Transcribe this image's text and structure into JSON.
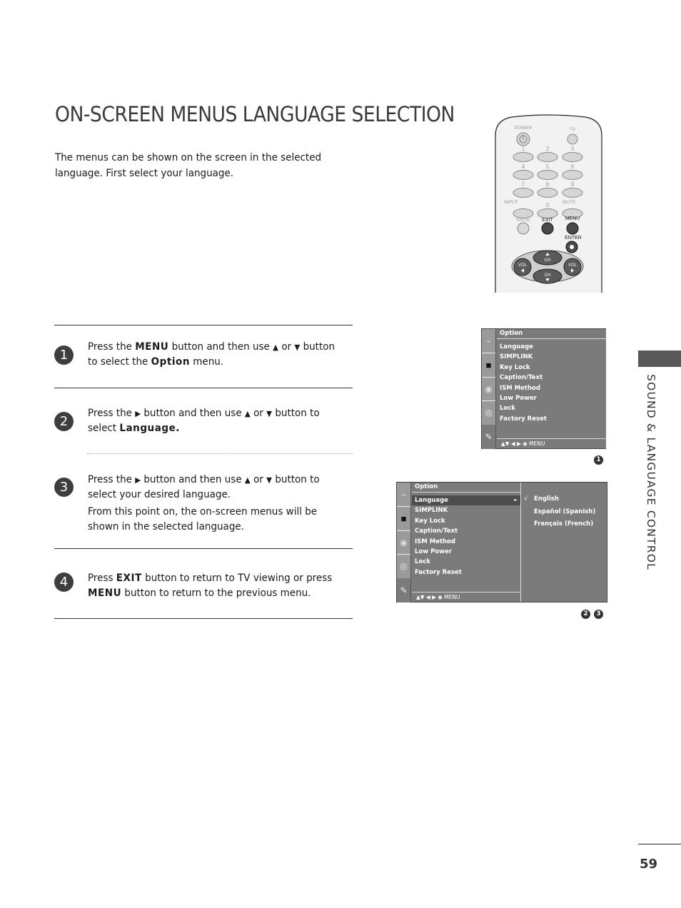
{
  "page": {
    "title": "ON-SCREEN MENUS LANGUAGE SELECTION",
    "intro": "The menus can be shown on the screen in the selected language. First select your language.",
    "section_label": "SOUND & LANGUAGE CONTROL",
    "page_number": "59"
  },
  "remote": {
    "labels": {
      "power": "POWER",
      "tv": "TV",
      "input": "INPUT",
      "mute": "MUTE",
      "ratio": "RATIO",
      "exit": "EXIT",
      "menu": "MENU",
      "enter": "ENTER",
      "ch": "CH",
      "vol": "VOL"
    },
    "digits": [
      "1",
      "2",
      "3",
      "4",
      "5",
      "6",
      "7",
      "8",
      "9",
      "0"
    ]
  },
  "steps": [
    {
      "number": "1",
      "parts": [
        "Press the ",
        "MENU",
        " button and then use ",
        "▲",
        " or ",
        "▼",
        " button to select the ",
        "Option",
        " menu."
      ]
    },
    {
      "number": "2",
      "parts": [
        "Press the ",
        "▶",
        " button and then use ",
        "▲",
        " or ",
        "▼",
        " button to select ",
        "Language."
      ]
    },
    {
      "number": "3",
      "parts": [
        "Press the ",
        "▶",
        " button and then use ",
        "▲",
        " or ",
        "▼",
        " button to select your desired language."
      ],
      "note": "From this point on, the on-screen menus will be shown in the selected language."
    },
    {
      "number": "4",
      "parts": [
        "Press ",
        "EXIT",
        " button to return to TV viewing or press ",
        "MENU",
        " button to return to the previous menu."
      ]
    }
  ],
  "osd": {
    "header": "Option",
    "items": [
      "Language",
      "SIMPLINK",
      "Key Lock",
      "Caption/Text",
      "ISM Method",
      "Low Power",
      "Lock",
      "Factory Reset"
    ],
    "footer": "▲▼  ◀ ▶   ◉   MENU",
    "side_icons": [
      "satellite-dish-icon",
      "screen-icon",
      "speaker-icon",
      "clock-icon",
      "tag-icon"
    ],
    "selected_item": "Language",
    "submenu_arrow": "►",
    "languages": [
      "English",
      "Español (Spanish)",
      "Français (French)"
    ],
    "selected_language": "English",
    "check_mark": "√",
    "badges_menu1": [
      "1"
    ],
    "badges_menu2": [
      "2",
      "3"
    ]
  }
}
